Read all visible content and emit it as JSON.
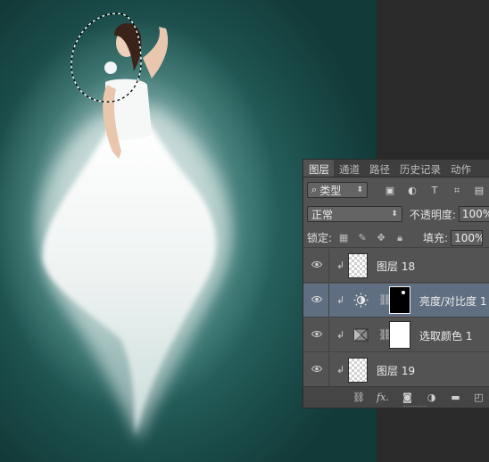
{
  "colors": {
    "canvas_bg": "#2a6763",
    "panel_bg": "#535353",
    "selected_row": "#5f6e80",
    "tab_bar": "#3e3e3e"
  },
  "tabs": [
    {
      "label": "图层",
      "active": true
    },
    {
      "label": "通道",
      "active": false
    },
    {
      "label": "路径",
      "active": false
    },
    {
      "label": "历史记录",
      "active": false
    },
    {
      "label": "动作",
      "active": false
    }
  ],
  "filter": {
    "kind_label": "类型",
    "icons": [
      "image-filter-icon",
      "adjustment-filter-icon",
      "type-filter-icon",
      "shape-filter-icon",
      "smart-object-filter-icon"
    ]
  },
  "blend": {
    "mode": "正常",
    "opacity_label": "不透明度:",
    "opacity_value": "100%"
  },
  "lock": {
    "label": "锁定:",
    "fill_label": "填充:",
    "fill_value": "100%",
    "icons": [
      "lock-transparent-icon",
      "lock-paint-icon",
      "lock-position-icon",
      "lock-all-icon"
    ]
  },
  "layers": [
    {
      "name": "图层 18",
      "type": "pixel",
      "clipped": true,
      "visible": true,
      "selected": false
    },
    {
      "name": "亮度/对比度 1",
      "type": "brightness-contrast",
      "clipped": true,
      "visible": true,
      "selected": true,
      "mask": "black"
    },
    {
      "name": "选取颜色 1",
      "type": "selective-color",
      "clipped": true,
      "visible": true,
      "selected": false,
      "mask": "white"
    },
    {
      "name": "图层 19",
      "type": "pixel",
      "clipped": true,
      "visible": true,
      "selected": false
    }
  ],
  "bottom_icons": [
    "link-layers-icon",
    "fx-icon",
    "add-mask-icon",
    "new-adjustment-icon",
    "new-group-icon",
    "new-layer-icon"
  ],
  "bottom_fx_label": "fx."
}
